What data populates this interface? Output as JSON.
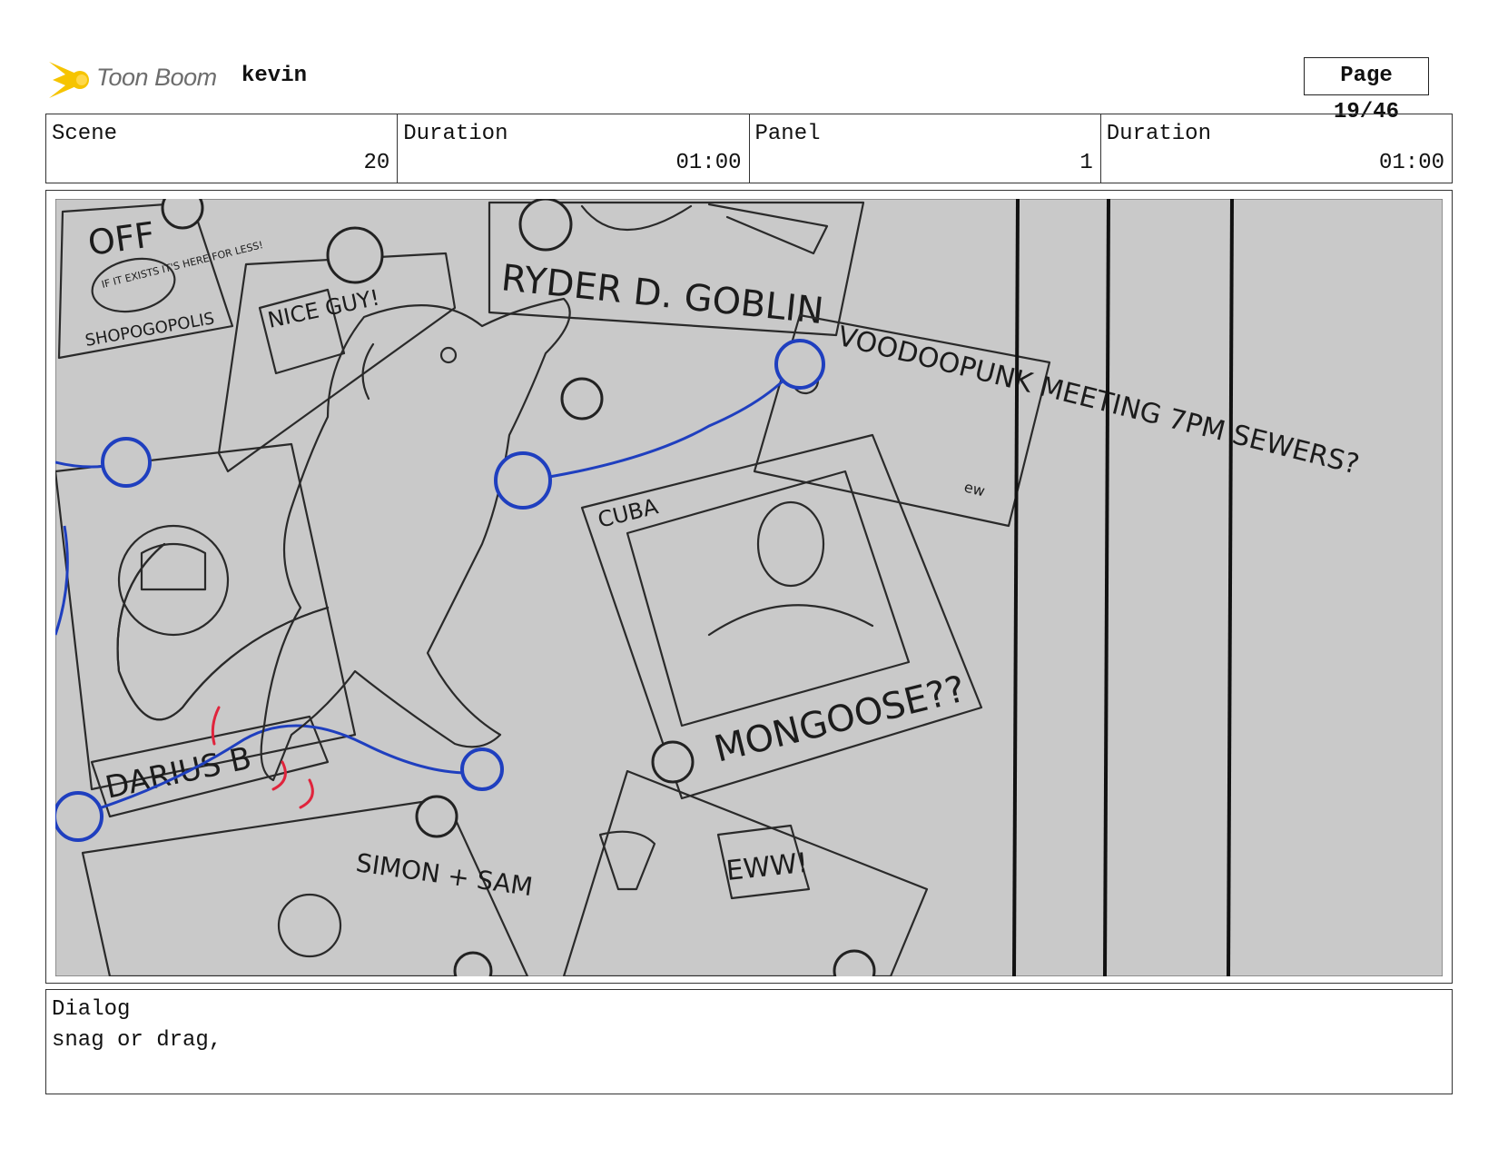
{
  "header": {
    "logo_text": "Toon Boom",
    "project_name": "kevin",
    "page_label": "Page 19/46"
  },
  "info": {
    "scene_label": "Scene",
    "scene_value": "20",
    "scene_duration_label": "Duration",
    "scene_duration_value": "01:00",
    "panel_label": "Panel",
    "panel_value": "1",
    "panel_duration_label": "Duration",
    "panel_duration_value": "01:00"
  },
  "sketch": {
    "texts": {
      "off": "OFF",
      "if_exists": "IF IT EXISTS IT'S HERE FOR LESS!",
      "shopogopolis": "SHOPOGOPOLIS",
      "nice_guy": "NICE GUY!",
      "ryder": "RYDER D. GOBLIN",
      "voodoopunk": "VOODOOPUNK MEETING 7PM SEWERS?",
      "ew": "ew",
      "cuba": "CUBA",
      "mongoose": "MONGOOSE??",
      "darius": "DARIUS B",
      "simon": "SIMON + SAM",
      "eww": "EWW!"
    },
    "colors": {
      "background": "#c9c9c9",
      "string": "#1f3fbf",
      "motion": "#e0243c"
    }
  },
  "dialog": {
    "label": "Dialog",
    "text": "snag or drag,"
  }
}
